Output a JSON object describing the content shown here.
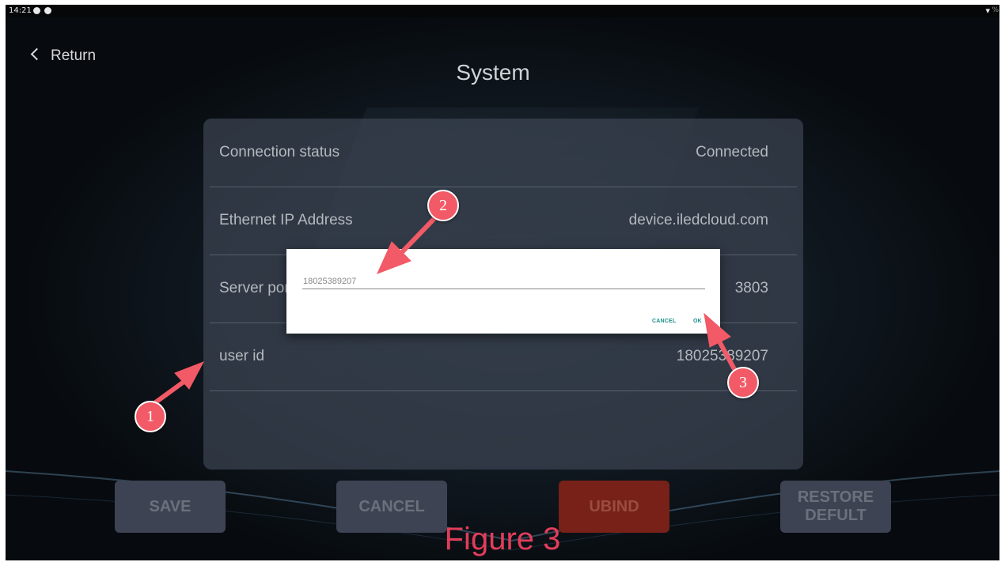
{
  "status_bar": {
    "time": "14:21",
    "wifi_icon": "wifi-icon",
    "battery_glyph": "%"
  },
  "header": {
    "return_label": "Return",
    "title": "System"
  },
  "settings": {
    "rows": [
      {
        "label": "Connection status",
        "value": "Connected"
      },
      {
        "label": "Ethernet IP Address",
        "value": "device.iledcloud.com"
      },
      {
        "label": "Server port",
        "value": "3803"
      },
      {
        "label": "user id",
        "value": "18025389207"
      }
    ]
  },
  "dialog": {
    "input_value": "18025389207",
    "cancel_label": "CANCEL",
    "ok_label": "OK"
  },
  "buttons": {
    "save": "SAVE",
    "cancel": "CANCEL",
    "unbind": "UBIND",
    "restore_line1": "RESTORE",
    "restore_line2": "DEFULT"
  },
  "annotations": {
    "marker1": "1",
    "marker2": "2",
    "marker3": "3",
    "caption": "Figure 3",
    "marker_color": "#f15a66",
    "caption_color": "#e23d5a"
  }
}
